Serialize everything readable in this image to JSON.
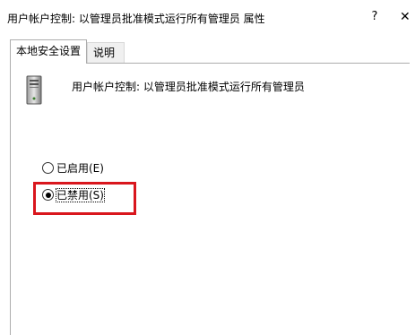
{
  "window": {
    "title": "用户帐户控制: 以管理员批准模式运行所有管理员 属性",
    "help_label": "?",
    "close_label": "✕"
  },
  "tabs": [
    {
      "label": "本地安全设置",
      "active": true
    },
    {
      "label": "说明",
      "active": false
    }
  ],
  "policy": {
    "icon": "computer-tower-icon",
    "name": "用户帐户控制: 以管理员批准模式运行所有管理员"
  },
  "options": [
    {
      "label": "已启用(E)",
      "selected": false
    },
    {
      "label": "已禁用(S)",
      "selected": true
    }
  ],
  "colors": {
    "highlight": "#d9161d",
    "tab_border": "#adadad"
  }
}
